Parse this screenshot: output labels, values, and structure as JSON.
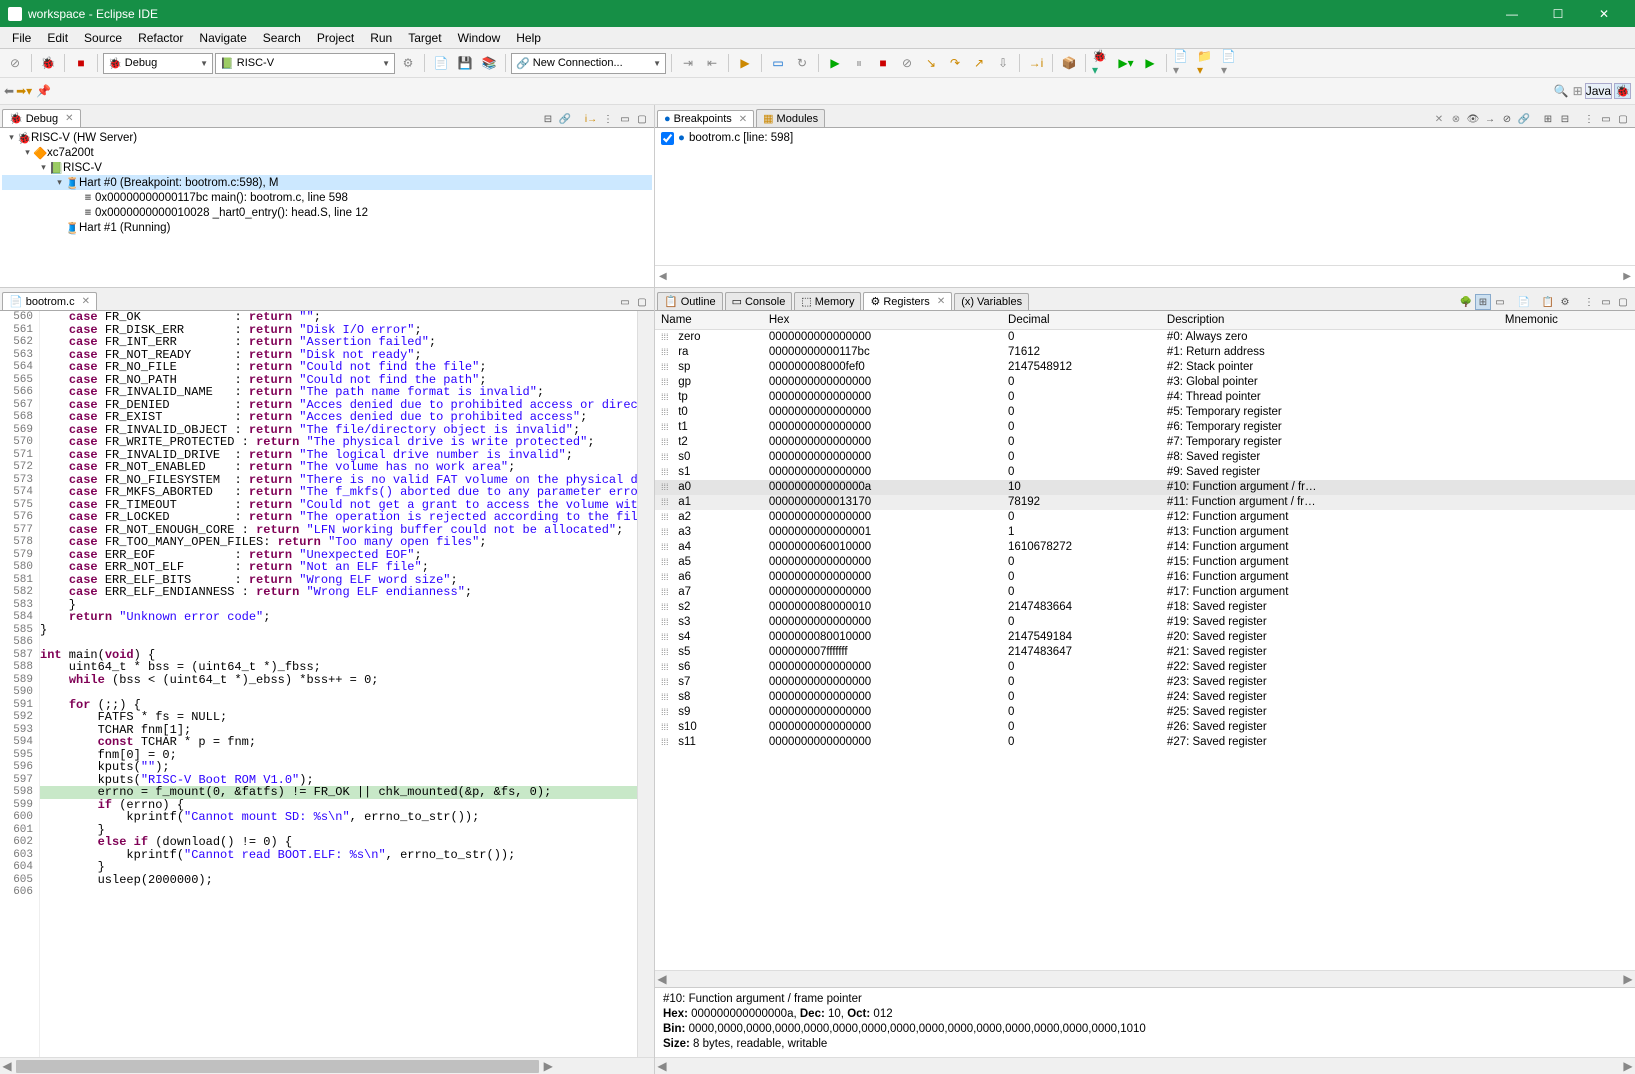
{
  "window": {
    "title": "workspace - Eclipse IDE"
  },
  "menu": [
    "File",
    "Edit",
    "Source",
    "Refactor",
    "Navigate",
    "Search",
    "Project",
    "Run",
    "Target",
    "Window",
    "Help"
  ],
  "topbar": {
    "combo_launch": "Debug",
    "combo_target": "RISC-V",
    "combo_conn": "New Connection...",
    "perspective": "Java"
  },
  "debug": {
    "label": "Debug",
    "tree": [
      {
        "d": 0,
        "e": "▾",
        "i": "🐞",
        "t": "RISC-V (HW Server)"
      },
      {
        "d": 1,
        "e": "▾",
        "i": "🔶",
        "t": "xc7a200t"
      },
      {
        "d": 2,
        "e": "▾",
        "i": "📗",
        "t": "RISC-V"
      },
      {
        "d": 3,
        "e": "▾",
        "i": "🧵",
        "t": "Hart #0 (Breakpoint: bootrom.c:598), M",
        "sel": true
      },
      {
        "d": 4,
        "e": "",
        "i": "≡",
        "t": "0x00000000000117bc main(): bootrom.c, line 598"
      },
      {
        "d": 4,
        "e": "",
        "i": "≡",
        "t": "0x0000000000010028 _hart0_entry(): head.S, line 12"
      },
      {
        "d": 3,
        "e": "",
        "i": "🧵",
        "t": "Hart #1 (Running)"
      }
    ]
  },
  "editor": {
    "tab": "bootrom.c",
    "first_line": 560,
    "lines": [
      "    case FR_OK             : return \"\";",
      "    case FR_DISK_ERR       : return \"Disk I/O error\";",
      "    case FR_INT_ERR        : return \"Assertion failed\";",
      "    case FR_NOT_READY      : return \"Disk not ready\";",
      "    case FR_NO_FILE        : return \"Could not find the file\";",
      "    case FR_NO_PATH        : return \"Could not find the path\";",
      "    case FR_INVALID_NAME   : return \"The path name format is invalid\";",
      "    case FR_DENIED         : return \"Acces denied due to prohibited access or directory full\";",
      "    case FR_EXIST          : return \"Acces denied due to prohibited access\";",
      "    case FR_INVALID_OBJECT : return \"The file/directory object is invalid\";",
      "    case FR_WRITE_PROTECTED : return \"The physical drive is write protected\";",
      "    case FR_INVALID_DRIVE  : return \"The logical drive number is invalid\";",
      "    case FR_NOT_ENABLED    : return \"The volume has no work area\";",
      "    case FR_NO_FILESYSTEM  : return \"There is no valid FAT volume on the physical drive\";",
      "    case FR_MKFS_ABORTED   : return \"The f_mkfs() aborted due to any parameter error\";",
      "    case FR_TIMEOUT        : return \"Could not get a grant to access the volume within defined period\";",
      "    case FR_LOCKED         : return \"The operation is rejected according to the file shareing policy\";",
      "    case FR_NOT_ENOUGH_CORE : return \"LFN working buffer could not be allocated\";",
      "    case FR_TOO_MANY_OPEN_FILES: return \"Too many open files\";",
      "    case ERR_EOF           : return \"Unexpected EOF\";",
      "    case ERR_NOT_ELF       : return \"Not an ELF file\";",
      "    case ERR_ELF_BITS      : return \"Wrong ELF word size\";",
      "    case ERR_ELF_ENDIANNESS : return \"Wrong ELF endianness\";",
      "    }",
      "    return \"Unknown error code\";",
      "}",
      "",
      "int main(void) {",
      "    uint64_t * bss = (uint64_t *)_fbss;",
      "    while (bss < (uint64_t *)_ebss) *bss++ = 0;",
      "",
      "    for (;;) {",
      "        FATFS * fs = NULL;",
      "        TCHAR fnm[1];",
      "        const TCHAR * p = fnm;",
      "        fnm[0] = 0;",
      "        kputs(\"\");",
      "        kputs(\"RISC-V Boot ROM V1.0\");",
      "        errno = f_mount(0, &fatfs) != FR_OK || chk_mounted(&p, &fs, 0);",
      "        if (errno) {",
      "            kprintf(\"Cannot mount SD: %s\\n\", errno_to_str());",
      "        }",
      "        else if (download() != 0) {",
      "            kprintf(\"Cannot read BOOT.ELF: %s\\n\", errno_to_str());",
      "        }",
      "        usleep(2000000);",
      ""
    ],
    "highlight_line": 598
  },
  "breakpoints": {
    "tab_bp": "Breakpoints",
    "tab_mod": "Modules",
    "items": [
      {
        "checked": true,
        "text": "bootrom.c [line: 598]"
      }
    ]
  },
  "right_tabs": [
    "Outline",
    "Console",
    "Memory",
    "Registers",
    "Variables"
  ],
  "right_active": 3,
  "registers": {
    "cols": [
      "Name",
      "Hex",
      "Decimal",
      "Description",
      "Mnemonic"
    ],
    "rows": [
      {
        "n": "zero",
        "h": "0000000000000000",
        "d": "0",
        "desc": "#0: Always zero"
      },
      {
        "n": "ra",
        "h": "00000000000117bc",
        "d": "71612",
        "desc": "#1: Return address"
      },
      {
        "n": "sp",
        "h": "000000008000fef0",
        "d": "2147548912",
        "desc": "#2: Stack pointer"
      },
      {
        "n": "gp",
        "h": "0000000000000000",
        "d": "0",
        "desc": "#3: Global pointer"
      },
      {
        "n": "tp",
        "h": "0000000000000000",
        "d": "0",
        "desc": "#4: Thread pointer"
      },
      {
        "n": "t0",
        "h": "0000000000000000",
        "d": "0",
        "desc": "#5: Temporary register"
      },
      {
        "n": "t1",
        "h": "0000000000000000",
        "d": "0",
        "desc": "#6: Temporary register"
      },
      {
        "n": "t2",
        "h": "0000000000000000",
        "d": "0",
        "desc": "#7: Temporary register"
      },
      {
        "n": "s0",
        "h": "0000000000000000",
        "d": "0",
        "desc": "#8: Saved register"
      },
      {
        "n": "s1",
        "h": "0000000000000000",
        "d": "0",
        "desc": "#9: Saved register"
      },
      {
        "n": "a0",
        "h": "000000000000000a",
        "d": "10",
        "desc": "#10: Function argument / fr…",
        "hl": 2
      },
      {
        "n": "a1",
        "h": "0000000000013170",
        "d": "78192",
        "desc": "#11: Function argument / fr…",
        "hl": 1
      },
      {
        "n": "a2",
        "h": "0000000000000000",
        "d": "0",
        "desc": "#12: Function argument"
      },
      {
        "n": "a3",
        "h": "0000000000000001",
        "d": "1",
        "desc": "#13: Function argument"
      },
      {
        "n": "a4",
        "h": "0000000060010000",
        "d": "1610678272",
        "desc": "#14: Function argument"
      },
      {
        "n": "a5",
        "h": "0000000000000000",
        "d": "0",
        "desc": "#15: Function argument"
      },
      {
        "n": "a6",
        "h": "0000000000000000",
        "d": "0",
        "desc": "#16: Function argument"
      },
      {
        "n": "a7",
        "h": "0000000000000000",
        "d": "0",
        "desc": "#17: Function argument"
      },
      {
        "n": "s2",
        "h": "0000000080000010",
        "d": "2147483664",
        "desc": "#18: Saved register"
      },
      {
        "n": "s3",
        "h": "0000000000000000",
        "d": "0",
        "desc": "#19: Saved register"
      },
      {
        "n": "s4",
        "h": "0000000080010000",
        "d": "2147549184",
        "desc": "#20: Saved register"
      },
      {
        "n": "s5",
        "h": "000000007fffffff",
        "d": "2147483647",
        "desc": "#21: Saved register"
      },
      {
        "n": "s6",
        "h": "0000000000000000",
        "d": "0",
        "desc": "#22: Saved register"
      },
      {
        "n": "s7",
        "h": "0000000000000000",
        "d": "0",
        "desc": "#23: Saved register"
      },
      {
        "n": "s8",
        "h": "0000000000000000",
        "d": "0",
        "desc": "#24: Saved register"
      },
      {
        "n": "s9",
        "h": "0000000000000000",
        "d": "0",
        "desc": "#25: Saved register"
      },
      {
        "n": "s10",
        "h": "0000000000000000",
        "d": "0",
        "desc": "#26: Saved register"
      },
      {
        "n": "s11",
        "h": "0000000000000000",
        "d": "0",
        "desc": "#27: Saved register"
      }
    ],
    "detail": {
      "line1": "#10: Function argument / frame pointer",
      "line2_a": "Hex:",
      "line2_b": "000000000000000a,",
      "line2_c": "Dec:",
      "line2_d": "10,",
      "line2_e": "Oct:",
      "line2_f": "012",
      "line3_a": "Bin:",
      "line3_b": "0000,0000,0000,0000,0000,0000,0000,0000,0000,0000,0000,0000,0000,0000,0000,1010",
      "line4_a": "Size:",
      "line4_b": "8 bytes, readable, writable"
    }
  }
}
